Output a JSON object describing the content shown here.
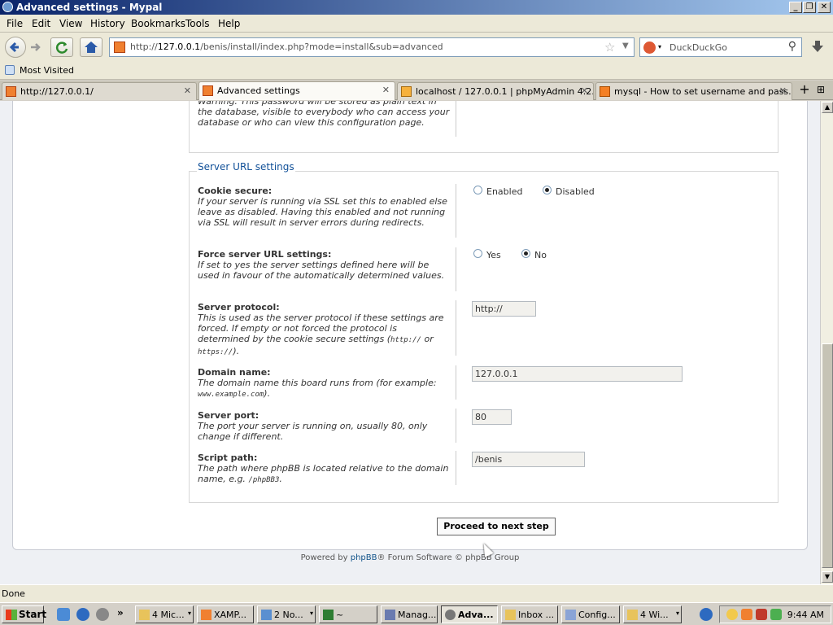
{
  "window": {
    "title": "Advanced settings - Mypal"
  },
  "menu": [
    "File",
    "Edit",
    "View",
    "History",
    "Bookmarks",
    "Tools",
    "Help"
  ],
  "nav": {
    "url_prefix": "http://",
    "url_host": "127.0.0.1",
    "url_path": "/benis/install/index.php?mode=install&sub=advanced",
    "search_placeholder": "DuckDuckGo"
  },
  "bookmarks": {
    "most_visited": "Most Visited"
  },
  "tabs": [
    {
      "label": "http://127.0.0.1/"
    },
    {
      "label": "Advanced settings"
    },
    {
      "label": "localhost / 127.0.0.1 | phpMyAdmin 4.2..."
    },
    {
      "label": "mysql - How to set username and pass..."
    }
  ],
  "top_section": {
    "warning_text": "Warning: This password will be stored as plain text in the database, visible to everybody who can access your database or who can view this configuration page."
  },
  "server_url_settings": {
    "legend": "Server URL settings",
    "cookie_secure": {
      "label": "Cookie secure:",
      "explain": "If your server is running via SSL set this to enabled else leave as disabled. Having this enabled and not running via SSL will result in server errors during redirects.",
      "opt_enabled": "Enabled",
      "opt_disabled": "Disabled",
      "selected": "Disabled"
    },
    "force_server": {
      "label": "Force server URL settings:",
      "explain": "If set to yes the server settings defined here will be used in favour of the automatically determined values.",
      "opt_yes": "Yes",
      "opt_no": "No",
      "selected": "No"
    },
    "server_protocol": {
      "label": "Server protocol:",
      "explain_a": "This is used as the server protocol if these settings are forced. If empty or not forced the protocol is determined by the cookie secure settings (",
      "code1": "http://",
      "explain_or": " or ",
      "code2": "https://",
      "explain_b": ").",
      "value": "http://"
    },
    "domain_name": {
      "label": "Domain name:",
      "explain_a": "The domain name this board runs from (for example: ",
      "code": "www.example.com",
      "explain_b": ").",
      "value": "127.0.0.1"
    },
    "server_port": {
      "label": "Server port:",
      "explain": "The port your server is running on, usually 80, only change if different.",
      "value": "80"
    },
    "script_path": {
      "label": "Script path:",
      "explain_a": "The path where phpBB is located relative to the domain name, e.g. ",
      "code": "/phpBB3",
      "explain_b": ".",
      "value": "/benis"
    }
  },
  "proceed_button": "Proceed to next step",
  "footer": {
    "prefix": "Powered by ",
    "link": "phpBB",
    "suffix": "® Forum Software © phpBB Group"
  },
  "status": "Done",
  "taskbar": {
    "start": "Start",
    "tasks": [
      "4 Mic...",
      "XAMP...",
      "2 No...",
      "~",
      "Manag...",
      "Adva...",
      "Inbox ...",
      "Config...",
      "4 Wi..."
    ],
    "clock": "9:44 AM"
  }
}
